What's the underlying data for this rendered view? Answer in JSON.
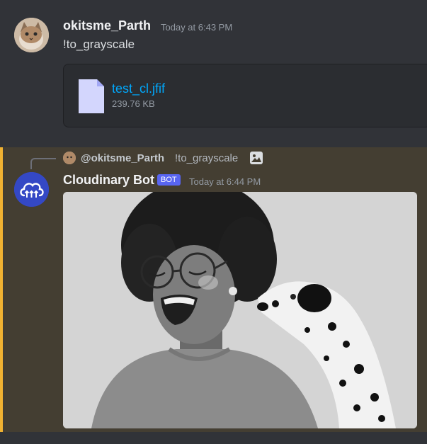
{
  "message1": {
    "username": "okitsme_Parth",
    "timestamp": "Today at 6:43 PM",
    "content": "!to_grayscale",
    "attachment": {
      "file_name": "test_cl.jfif",
      "file_size": "239.76 KB",
      "icon": "file-icon"
    }
  },
  "message2": {
    "reply": {
      "username": "@okitsme_Parth",
      "content": "!to_grayscale",
      "icon": "image-icon"
    },
    "username": "Cloudinary Bot",
    "badge": "BOT",
    "timestamp": "Today at 6:44 PM",
    "avatar_icon": "cloudinary-logo",
    "image_description_icon": "grayscale-photo"
  },
  "colors": {
    "background": "#313338",
    "mention_highlight": "#443e32",
    "mention_bar": "#f0b232",
    "link": "#00a8fc",
    "bot_badge": "#5865f2",
    "cloudinary_blue": "#3448c5"
  }
}
